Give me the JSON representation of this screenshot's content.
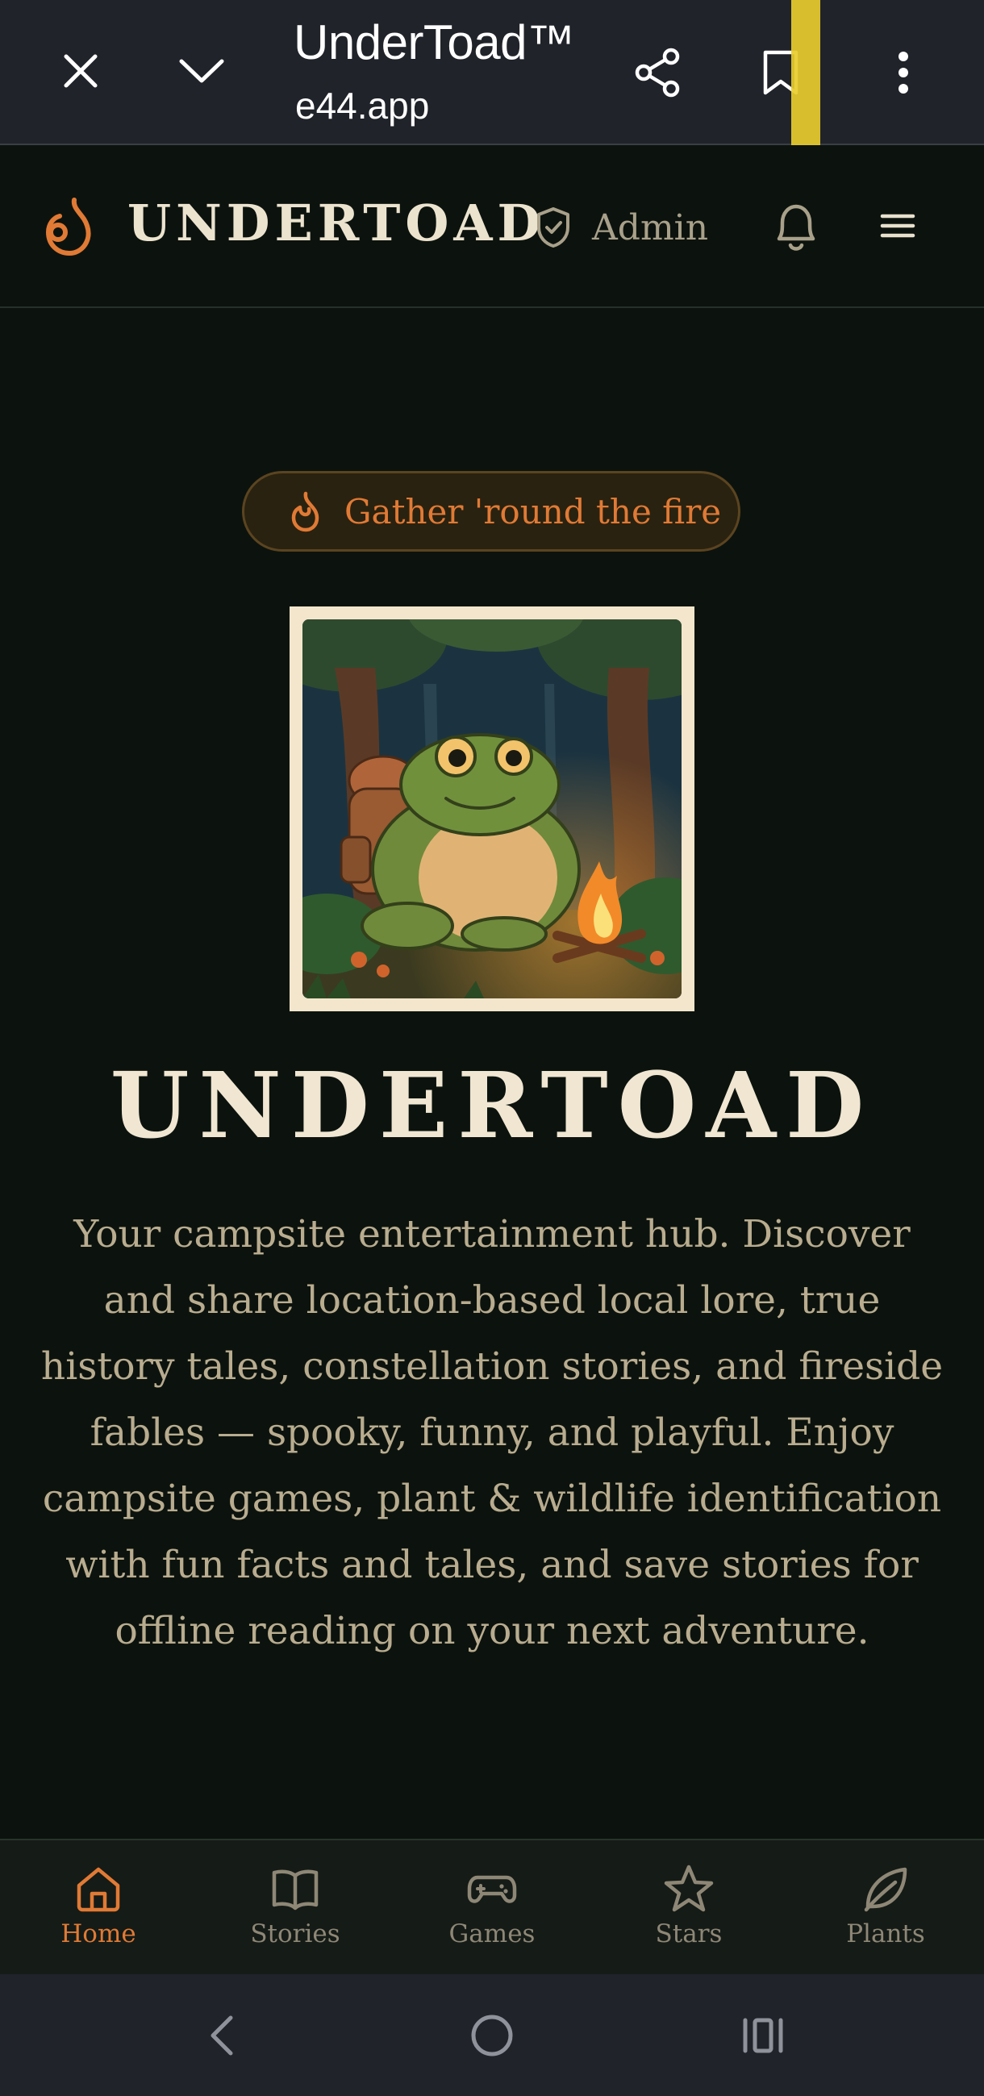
{
  "browser": {
    "page_title": "UnderToad™",
    "url_faded": "",
    "url_visible": "e44.app"
  },
  "header": {
    "brand": "UNDERTOAD",
    "admin_label": "Admin"
  },
  "hero": {
    "badge": "Gather 'round the fire",
    "title": "UNDERTOAD",
    "description": "Your campsite entertainment hub. Discover and share location-based local lore, true history tales, constellation stories, and fireside fables — spooky, funny, and playful. Enjoy campsite games, plant & wildlife identification with fun facts and tales, and save stories for offline reading on your next adventure."
  },
  "bottom_nav": {
    "items": [
      {
        "label": "Home",
        "icon": "home-icon",
        "active": true
      },
      {
        "label": "Stories",
        "icon": "book-icon",
        "active": false
      },
      {
        "label": "Games",
        "icon": "gamepad-icon",
        "active": false
      },
      {
        "label": "Stars",
        "icon": "star-icon",
        "active": false
      },
      {
        "label": "Plants",
        "icon": "leaf-icon",
        "active": false
      }
    ]
  },
  "colors": {
    "background": "#0c130e",
    "accent": "#e07a35",
    "brand_text": "#ece3cf",
    "muted_text": "#b9ac8f",
    "browser_chrome": "#20232a"
  }
}
